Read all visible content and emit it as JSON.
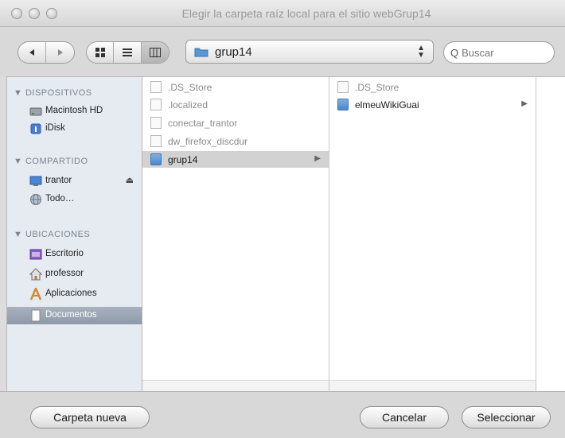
{
  "window": {
    "title": "Elegir la carpeta raíz local para el sitio webGrup14"
  },
  "toolbar": {
    "back_icon": "back-arrow",
    "forward_icon": "forward-arrow",
    "view_modes": [
      "icons",
      "list",
      "columns"
    ],
    "location": "grup14",
    "search_placeholder": "Buscar"
  },
  "sidebar": {
    "sections": [
      {
        "title": "DISPOSITIVOS",
        "items": [
          {
            "label": "Macintosh HD",
            "icon": "hard-drive"
          },
          {
            "label": "iDisk",
            "icon": "idisk"
          }
        ]
      },
      {
        "title": "COMPARTIDO",
        "items": [
          {
            "label": "trantor",
            "icon": "network-computer"
          },
          {
            "label": "Todo…",
            "icon": "network-globe"
          }
        ]
      },
      {
        "title": "UBICACIONES",
        "items": [
          {
            "label": "Escritorio",
            "icon": "desktop"
          },
          {
            "label": "professor",
            "icon": "home"
          },
          {
            "label": "Aplicaciones",
            "icon": "applications"
          },
          {
            "label": "Documentos",
            "icon": "documents",
            "selected": true
          }
        ]
      }
    ]
  },
  "columns": [
    {
      "items": [
        {
          "label": ".DS_Store",
          "type": "file",
          "dim": true
        },
        {
          "label": ".localized",
          "type": "file",
          "dim": true
        },
        {
          "label": "conectar_trantor",
          "type": "file",
          "dim": true
        },
        {
          "label": "dw_firefox_discdur",
          "type": "file",
          "dim": true
        },
        {
          "label": "grup14",
          "type": "folder",
          "selected": true
        }
      ]
    },
    {
      "items": [
        {
          "label": ".DS_Store",
          "type": "file",
          "dim": true
        },
        {
          "label": "elmeuWikiGuai",
          "type": "folder"
        }
      ]
    }
  ],
  "buttons": {
    "new_folder": "Carpeta nueva",
    "cancel": "Cancelar",
    "select": "Seleccionar"
  }
}
